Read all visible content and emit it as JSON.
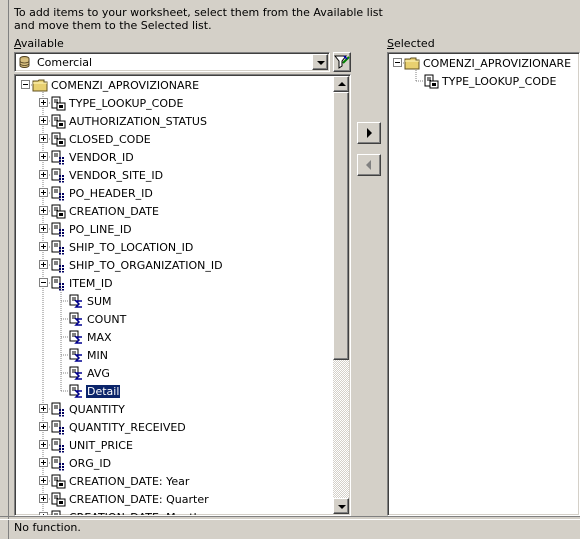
{
  "instruction": "To add items to your worksheet, select them from the Available list and move them to the Selected list.",
  "available_label_accel": "A",
  "available_label_rest": "vailable",
  "selected_label_accel": "S",
  "selected_label_rest": "elected",
  "business_area": "Comercial",
  "available_tree": [
    {
      "label": "COMENZI_APROVIZIONARE",
      "level": 0,
      "expander": "minus",
      "icon": "folder-icon"
    },
    {
      "label": "TYPE_LOOKUP_CODE",
      "level": 1,
      "expander": "plus",
      "icon": "lov-item-icon"
    },
    {
      "label": "AUTHORIZATION_STATUS",
      "level": 1,
      "expander": "plus",
      "icon": "lov-item-icon"
    },
    {
      "label": "CLOSED_CODE",
      "level": 1,
      "expander": "plus",
      "icon": "lov-item-icon"
    },
    {
      "label": "VENDOR_ID",
      "level": 1,
      "expander": "plus",
      "icon": "numeric-item-icon"
    },
    {
      "label": "VENDOR_SITE_ID",
      "level": 1,
      "expander": "plus",
      "icon": "numeric-item-icon"
    },
    {
      "label": "PO_HEADER_ID",
      "level": 1,
      "expander": "plus",
      "icon": "numeric-item-icon"
    },
    {
      "label": "CREATION_DATE",
      "level": 1,
      "expander": "plus",
      "icon": "lov-item-icon"
    },
    {
      "label": "PO_LINE_ID",
      "level": 1,
      "expander": "plus",
      "icon": "numeric-item-icon"
    },
    {
      "label": "SHIP_TO_LOCATION_ID",
      "level": 1,
      "expander": "plus",
      "icon": "numeric-item-icon"
    },
    {
      "label": "SHIP_TO_ORGANIZATION_ID",
      "level": 1,
      "expander": "plus",
      "icon": "numeric-item-icon"
    },
    {
      "label": "ITEM_ID",
      "level": 1,
      "expander": "minus",
      "icon": "numeric-item-icon"
    },
    {
      "label": "SUM",
      "level": 2,
      "expander": "none",
      "icon": "sigma-icon"
    },
    {
      "label": "COUNT",
      "level": 2,
      "expander": "none",
      "icon": "sigma-icon"
    },
    {
      "label": "MAX",
      "level": 2,
      "expander": "none",
      "icon": "sigma-icon"
    },
    {
      "label": "MIN",
      "level": 2,
      "expander": "none",
      "icon": "sigma-icon"
    },
    {
      "label": "AVG",
      "level": 2,
      "expander": "none",
      "icon": "sigma-icon"
    },
    {
      "label": "Detail",
      "level": 2,
      "expander": "none",
      "icon": "sigma-icon",
      "selected": true
    },
    {
      "label": "QUANTITY",
      "level": 1,
      "expander": "plus",
      "icon": "numeric-item-icon"
    },
    {
      "label": "QUANTITY_RECEIVED",
      "level": 1,
      "expander": "plus",
      "icon": "numeric-item-icon"
    },
    {
      "label": "UNIT_PRICE",
      "level": 1,
      "expander": "plus",
      "icon": "numeric-item-icon"
    },
    {
      "label": "ORG_ID",
      "level": 1,
      "expander": "plus",
      "icon": "numeric-item-icon"
    },
    {
      "label": "CREATION_DATE: Year",
      "level": 1,
      "expander": "plus",
      "icon": "lov-item-icon"
    },
    {
      "label": "CREATION_DATE: Quarter",
      "level": 1,
      "expander": "plus",
      "icon": "lov-item-icon"
    },
    {
      "label": "CREATION_DATE: Month",
      "level": 1,
      "expander": "plus",
      "icon": "lov-item-icon"
    }
  ],
  "selected_tree": [
    {
      "label": "COMENZI_APROVIZIONARE",
      "level": 0,
      "expander": "minus",
      "icon": "folder-icon"
    },
    {
      "label": "TYPE_LOOKUP_CODE",
      "level": 1,
      "expander": "none",
      "icon": "lov-item-icon"
    }
  ],
  "status_text": "No function."
}
